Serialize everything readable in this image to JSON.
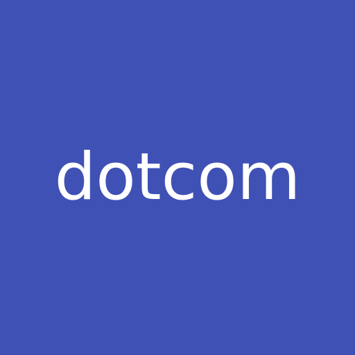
{
  "app": {
    "wordmark": "dotcom"
  },
  "colors": {
    "background": "#3f51b5",
    "text": "#ffffff"
  }
}
